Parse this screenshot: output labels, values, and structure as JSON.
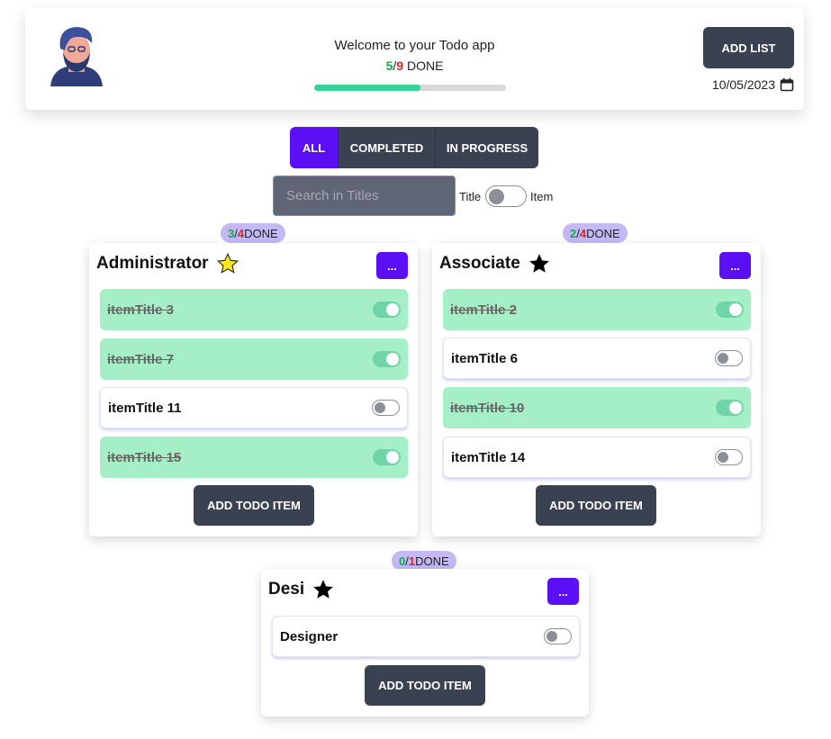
{
  "header": {
    "welcome_text": "Welcome to your Todo app",
    "done_count": "5",
    "total_count": "9",
    "done_label": "DONE",
    "progress_fraction": 0.556,
    "add_list_label": "ADD LIST",
    "date": "10/05/2023"
  },
  "filters": {
    "tabs": [
      "ALL",
      "COMPLETED",
      "IN PROGRESS"
    ],
    "active": "ALL"
  },
  "search": {
    "placeholder": "Search in Titles",
    "option_title": "Title",
    "option_item": "Item"
  },
  "lists": [
    {
      "title": "Administrator",
      "star": "yellow-star-icon",
      "done": "3",
      "total": "4",
      "done_label": "DONE",
      "more_label": "...",
      "add_label": "ADD TODO ITEM",
      "items": [
        {
          "label": "itemTitle 3",
          "completed": true
        },
        {
          "label": "itemTitle 7",
          "completed": true
        },
        {
          "label": "itemTitle 11",
          "completed": false
        },
        {
          "label": "itemTitle 15",
          "completed": true
        }
      ]
    },
    {
      "title": "Associate",
      "star": "black-star-icon",
      "done": "2",
      "total": "4",
      "done_label": "DONE",
      "more_label": "...",
      "add_label": "ADD TODO ITEM",
      "items": [
        {
          "label": "itemTitle 2",
          "completed": true
        },
        {
          "label": "itemTitle 6",
          "completed": false
        },
        {
          "label": "itemTitle 10",
          "completed": true
        },
        {
          "label": "itemTitle 14",
          "completed": false
        }
      ]
    },
    {
      "title": "Desi",
      "star": "black-star-icon",
      "done": "0",
      "total": "1",
      "done_label": "DONE",
      "more_label": "...",
      "add_label": "ADD TODO ITEM",
      "items": [
        {
          "label": "Designer",
          "completed": false
        }
      ]
    }
  ],
  "colors": {
    "accent": "#5b0ff5",
    "dark_button": "#3a4150",
    "done_bg": "#a5efc6",
    "progress": "#34d399",
    "badge": "#c4b8f5"
  }
}
